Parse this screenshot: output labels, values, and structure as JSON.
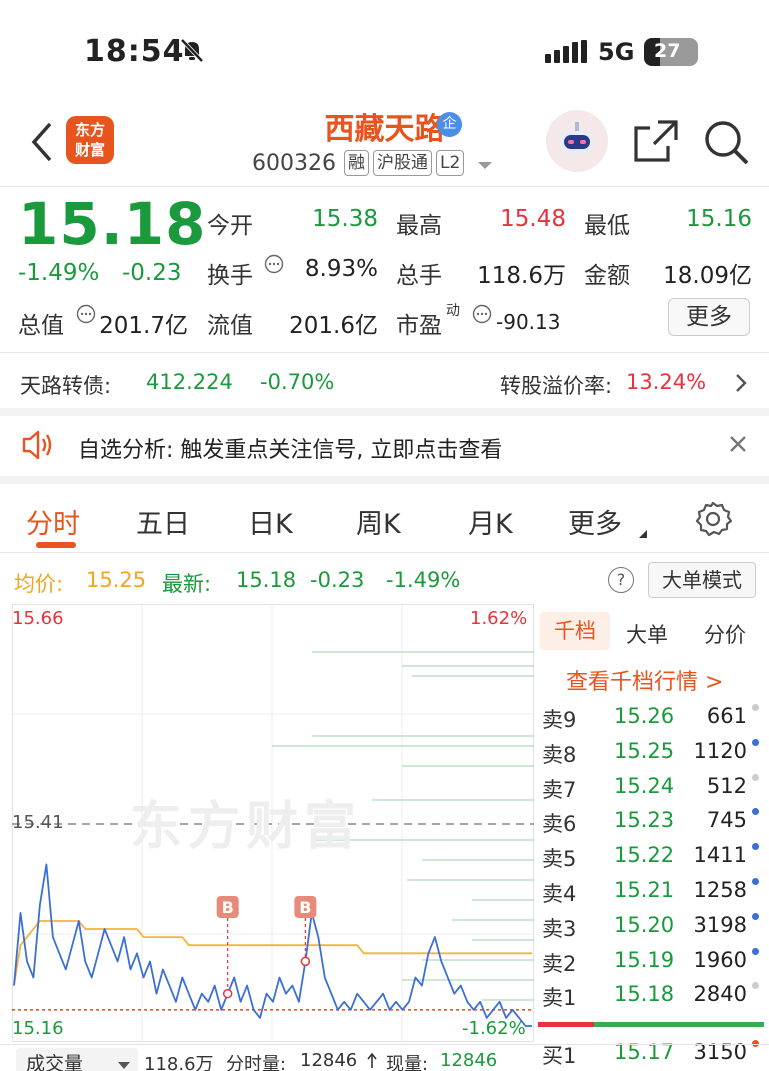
{
  "status": {
    "time": "18:54",
    "network": "5G",
    "battery": "27"
  },
  "header": {
    "logo_text": "东方财富",
    "stock_name": "西藏天路",
    "stock_code": "600326",
    "tags": [
      "融",
      "沪股通",
      "L2"
    ],
    "badge": "企"
  },
  "quote": {
    "price": "15.18",
    "change_pct": "-1.49%",
    "change": "-0.23",
    "open_label": "今开",
    "open": "15.38",
    "high_label": "最高",
    "high": "15.48",
    "low_label": "最低",
    "low": "15.16",
    "turnover_label": "换手",
    "turnover": "8.93%",
    "volume_label": "总手",
    "volume": "118.6万",
    "amount_label": "金额",
    "amount": "18.09亿",
    "mcap_label": "总值",
    "mcap": "201.7亿",
    "float_label": "流值",
    "float": "201.6亿",
    "pe_label": "市盈",
    "pe_sup": "动",
    "pe": "-90.13",
    "more_label": "更多"
  },
  "bond": {
    "label": "天路转债:",
    "price": "412.224",
    "change": "-0.70%",
    "premium_label": "转股溢价率:",
    "premium": "13.24%"
  },
  "alert": {
    "text": "自选分析: 触发重点关注信号, 立即点击查看"
  },
  "tabs": [
    "分时",
    "五日",
    "日K",
    "周K",
    "月K",
    "更多"
  ],
  "chart_info": {
    "avg_label": "均价:",
    "avg": "15.25",
    "latest_label": "最新:",
    "latest": "15.18",
    "change": "-0.23",
    "change_pct": "-1.49%",
    "mode_button": "大单模式",
    "help_icon": "?"
  },
  "chart_axis": {
    "top_price": "15.66",
    "bottom_price": "15.16",
    "mid_price": "15.41",
    "top_pct": "1.62%",
    "bottom_pct": "-1.62%",
    "watermark": "东方财富"
  },
  "chart_data": {
    "type": "line",
    "title": "",
    "ylim": [
      15.16,
      15.66
    ],
    "prev_close": 15.41,
    "series": [
      {
        "name": "",
        "values": [
          15.21,
          15.3,
          15.24,
          15.22,
          15.31,
          15.36,
          15.27,
          15.25,
          15.23,
          15.26,
          15.29,
          15.24,
          15.22,
          15.25,
          15.28,
          15.26,
          15.24,
          15.27,
          15.23,
          15.25,
          15.22,
          15.24,
          15.2,
          15.23,
          15.21,
          15.19,
          15.22,
          15.2,
          15.18,
          15.2,
          15.19,
          15.21,
          15.18,
          15.2,
          15.22,
          15.19,
          15.21,
          15.18,
          15.17,
          15.2,
          15.19,
          15.22,
          15.2,
          15.21,
          15.19,
          15.24,
          15.3,
          15.27,
          15.22,
          15.2,
          15.18,
          15.19,
          15.18,
          15.2,
          15.19,
          15.18,
          15.19,
          15.2,
          15.18,
          15.19,
          15.18,
          15.19,
          15.22,
          15.21,
          15.25,
          15.27,
          15.24,
          15.22,
          15.2,
          15.21,
          15.19,
          15.18,
          15.19,
          15.17,
          15.18,
          15.19,
          15.17,
          15.18,
          15.17,
          15.16,
          15.16
        ]
      },
      {
        "name": "均价",
        "values": [
          15.21,
          15.26,
          15.27,
          15.28,
          15.29,
          15.29,
          15.29,
          15.29,
          15.29,
          15.29,
          15.29,
          15.28,
          15.28,
          15.28,
          15.28,
          15.28,
          15.28,
          15.28,
          15.28,
          15.28,
          15.27,
          15.27,
          15.27,
          15.27,
          15.27,
          15.27,
          15.27,
          15.26,
          15.26,
          15.26,
          15.26,
          15.26,
          15.26,
          15.26,
          15.26,
          15.26,
          15.26,
          15.26,
          15.26,
          15.26,
          15.26,
          15.26,
          15.26,
          15.26,
          15.26,
          15.26,
          15.26,
          15.26,
          15.26,
          15.26,
          15.26,
          15.26,
          15.26,
          15.26,
          15.25,
          15.25,
          15.25,
          15.25,
          15.25,
          15.25,
          15.25,
          15.25,
          15.25,
          15.25,
          15.25,
          15.25,
          15.25,
          15.25,
          15.25,
          15.25,
          15.25,
          15.25,
          15.25,
          15.25,
          15.25,
          15.25,
          15.25,
          15.25,
          15.25,
          15.25,
          15.25
        ]
      }
    ],
    "markers": [
      {
        "label": "B",
        "index": 33
      },
      {
        "label": "B",
        "index": 45
      }
    ]
  },
  "orderbook": {
    "tabs": [
      "千档",
      "大单",
      "分价"
    ],
    "link": "查看千档行情 >",
    "asks": [
      {
        "label": "卖9",
        "price": "15.26",
        "vol": "661",
        "dot": "#cccccc"
      },
      {
        "label": "卖8",
        "price": "15.25",
        "vol": "1120",
        "dot": "#3b6fd6"
      },
      {
        "label": "卖7",
        "price": "15.24",
        "vol": "512",
        "dot": "#cccccc"
      },
      {
        "label": "卖6",
        "price": "15.23",
        "vol": "745",
        "dot": "#3b6fd6"
      },
      {
        "label": "卖5",
        "price": "15.22",
        "vol": "1411",
        "dot": "#3b6fd6"
      },
      {
        "label": "卖4",
        "price": "15.21",
        "vol": "1258",
        "dot": "#3b6fd6"
      },
      {
        "label": "卖3",
        "price": "15.20",
        "vol": "3198",
        "dot": "#3b6fd6"
      },
      {
        "label": "卖2",
        "price": "15.19",
        "vol": "1960",
        "dot": "#3b6fd6"
      },
      {
        "label": "卖1",
        "price": "15.18",
        "vol": "2840",
        "dot": "#cccccc"
      }
    ],
    "bids": [
      {
        "label": "买1",
        "price": "15.17",
        "vol": "3150",
        "dot": "#e8541e"
      }
    ]
  },
  "volume_bar": {
    "selector": "成交量",
    "total": "118.6万",
    "time_label": "分时量:",
    "time_val": "12846",
    "now_label": "现量:",
    "now_val": "12846"
  },
  "colors": {
    "accent": "#e8541e",
    "up": "#e8323c",
    "down": "#1a9a3c",
    "line": "#3b6fd6",
    "avg": "#f2b53c"
  }
}
